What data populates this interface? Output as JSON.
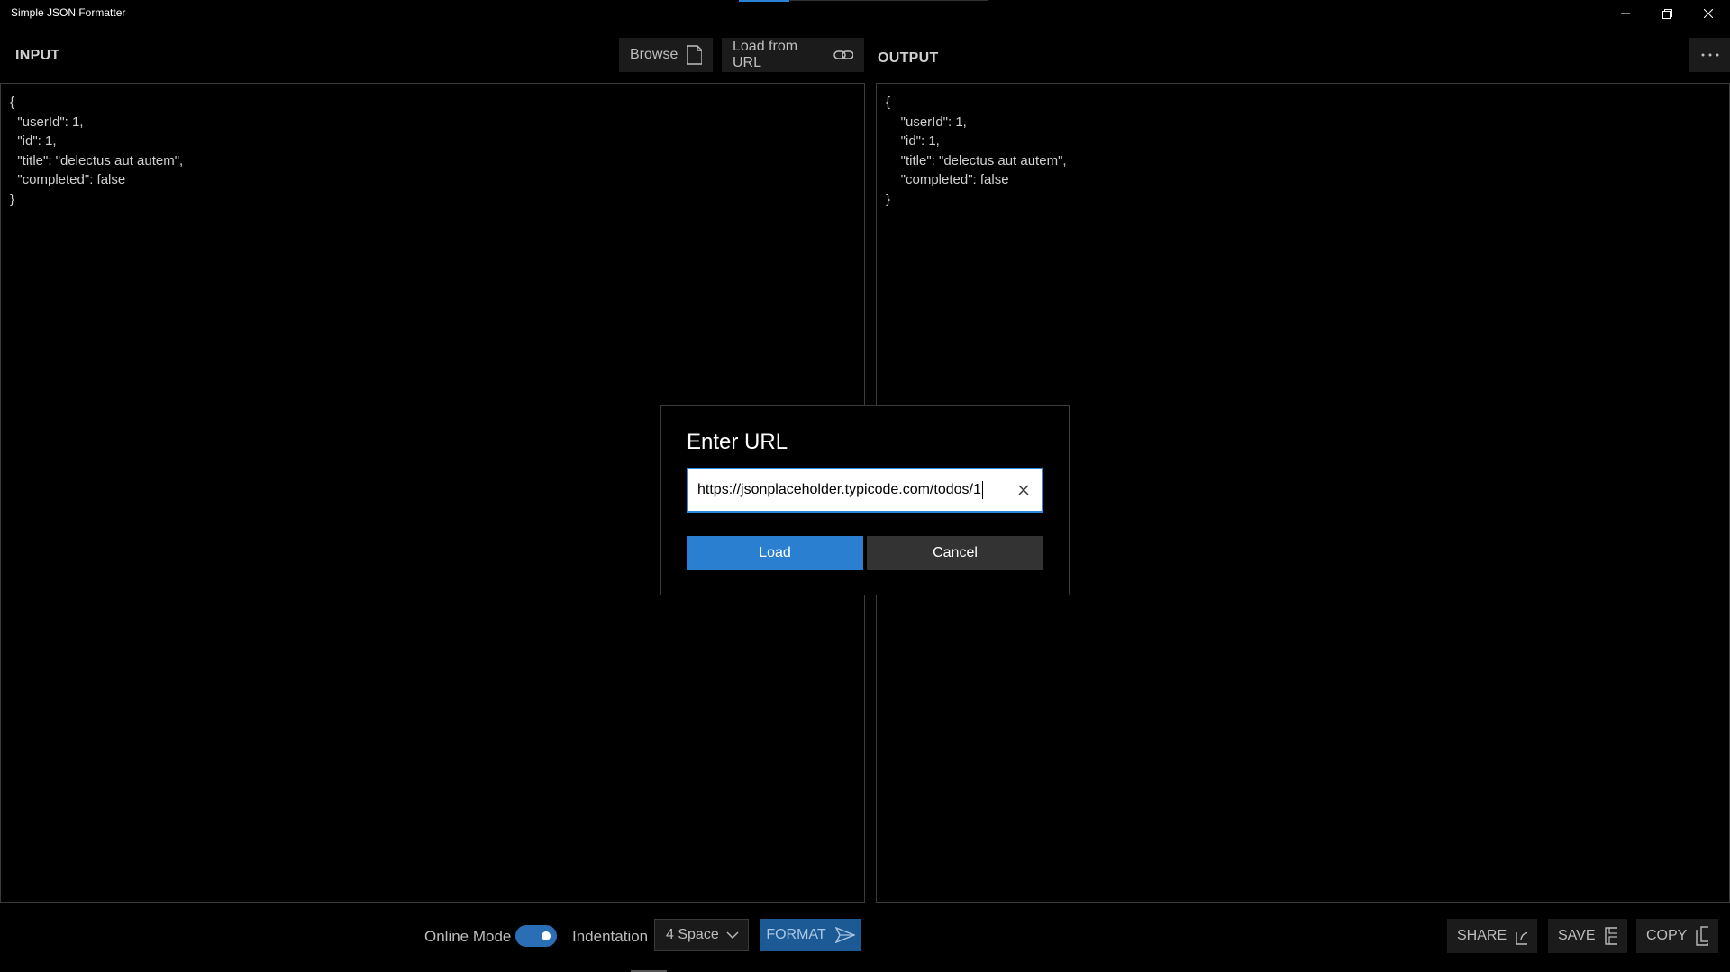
{
  "window": {
    "title": "Simple JSON Formatter"
  },
  "input": {
    "label": "INPUT",
    "browse_label": "Browse",
    "load_url_label": "Load from URL",
    "lines": [
      "{",
      "  \"userId\": 1,",
      "  \"id\": 1,",
      "  \"title\": \"delectus aut autem\",",
      "  \"completed\": false",
      "}"
    ]
  },
  "output": {
    "label": "OUTPUT",
    "lines": [
      "{",
      "    \"userId\": 1,",
      "    \"id\": 1,",
      "    \"title\": \"delectus aut autem\",",
      "    \"completed\": false",
      "}"
    ]
  },
  "bottom": {
    "online_mode_label": "Online Mode",
    "online_mode_on": true,
    "indentation_label": "Indentation",
    "indentation_value": "4 Space",
    "format_label": "FORMAT",
    "share_label": "SHARE",
    "save_label": "SAVE",
    "copy_label": "COPY"
  },
  "dialog": {
    "title": "Enter URL",
    "url_value": "https://jsonplaceholder.typicode.com/todos/1",
    "load_label": "Load",
    "cancel_label": "Cancel"
  },
  "colors": {
    "accent": "#2a7fd0",
    "background": "#000000",
    "panel_button": "#1b1b1b"
  }
}
